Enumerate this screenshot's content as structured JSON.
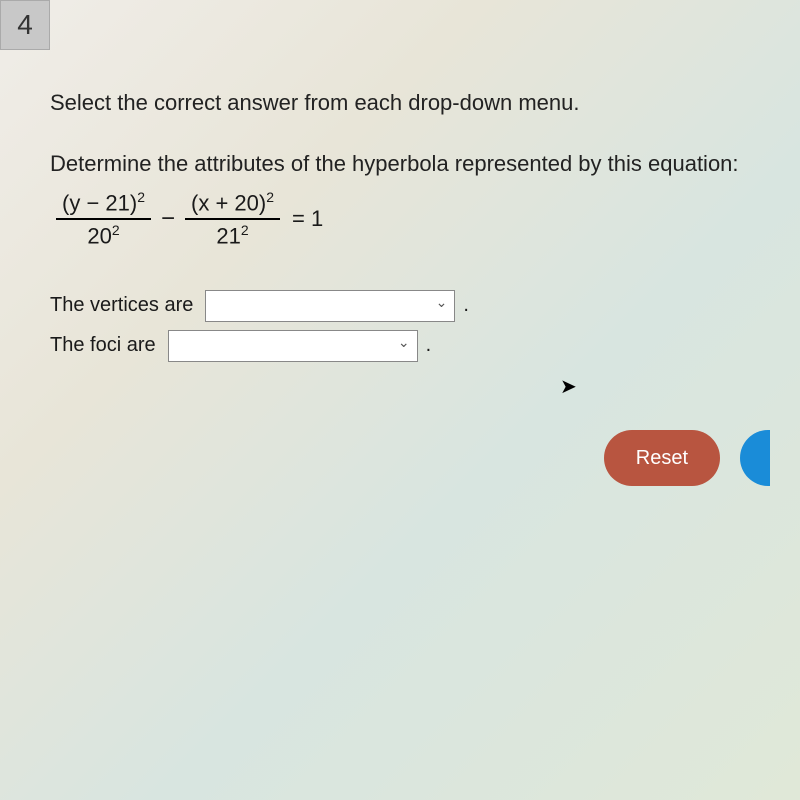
{
  "question_number": "4",
  "instruction": "Select the correct answer from each drop-down menu.",
  "determine_text": "Determine the attributes of the hyperbola represented by this equation:",
  "equation": {
    "frac1_num": "(y − 21)",
    "frac1_num_sup": "2",
    "frac1_den": "20",
    "frac1_den_sup": "2",
    "minus": "−",
    "frac2_num": "(x + 20)",
    "frac2_num_sup": "2",
    "frac2_den": "21",
    "frac2_den_sup": "2",
    "equals": "= 1"
  },
  "answers": {
    "vertices_label": "The vertices are",
    "foci_label": "The foci are"
  },
  "reset_label": "Reset",
  "period": "."
}
